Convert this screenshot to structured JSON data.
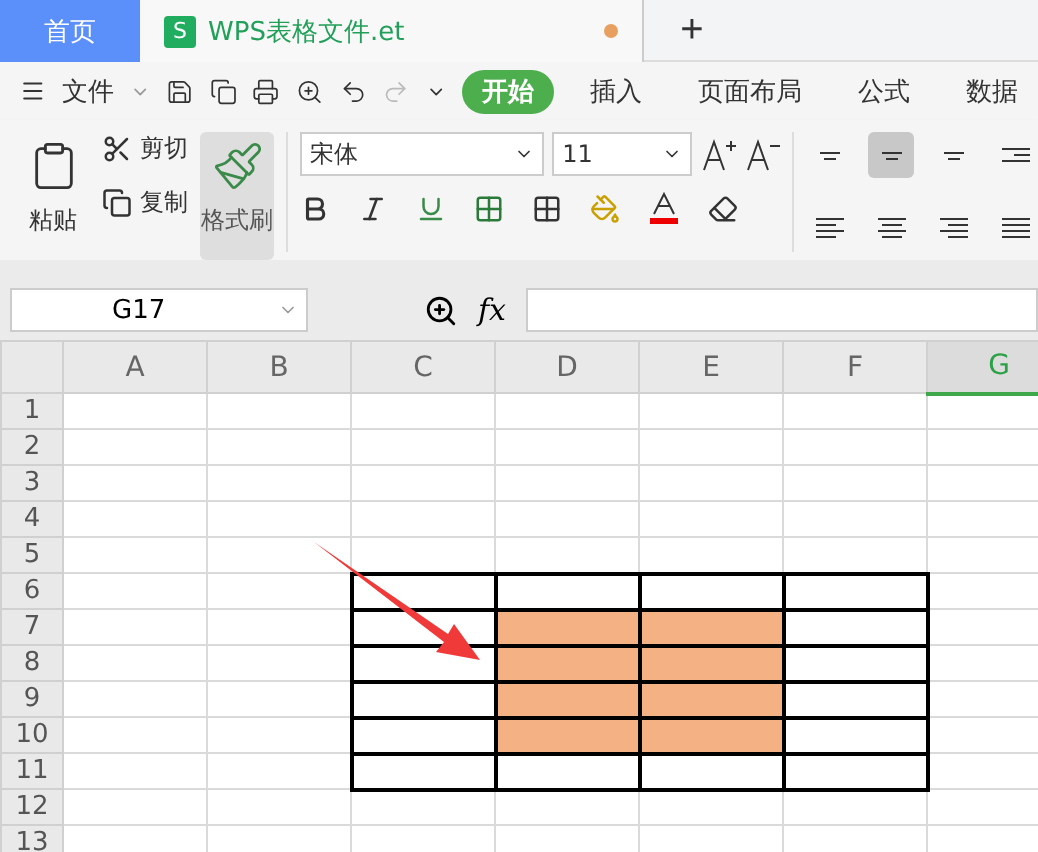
{
  "tabs": [
    {
      "label": "首页",
      "kind": "home",
      "selected": false
    },
    {
      "label": "WPS表格文件.et",
      "kind": "document",
      "selected": true,
      "modified": true,
      "logo": "S"
    }
  ],
  "new_tab": "+",
  "menu": {
    "file": "文件",
    "items": [
      {
        "label": "开始",
        "selected": true
      },
      {
        "label": "插入",
        "selected": false
      },
      {
        "label": "页面布局",
        "selected": false
      },
      {
        "label": "公式",
        "selected": false
      },
      {
        "label": "数据",
        "selected": false
      }
    ]
  },
  "ribbon": {
    "paste": "粘贴",
    "cut": "剪切",
    "copy": "复制",
    "format_painter": {
      "label": "格式刷",
      "pressed": true
    },
    "font": "宋体",
    "size": "11",
    "align": [
      {
        "kind": "top",
        "selected": false
      },
      {
        "kind": "middle",
        "selected": true
      },
      {
        "kind": "bottom",
        "selected": false
      },
      {
        "kind": "indent",
        "selected": false
      },
      {
        "kind": "left",
        "selected": false
      },
      {
        "kind": "center",
        "selected": false
      },
      {
        "kind": "right",
        "selected": false
      },
      {
        "kind": "justify",
        "selected": false
      }
    ]
  },
  "name_box": "G17",
  "formula_label": "fx",
  "sheet": {
    "columns": [
      {
        "label": "A",
        "selected": false
      },
      {
        "label": "B",
        "selected": false
      },
      {
        "label": "C",
        "selected": false
      },
      {
        "label": "D",
        "selected": false
      },
      {
        "label": "E",
        "selected": false
      },
      {
        "label": "F",
        "selected": false
      },
      {
        "label": "G",
        "selected": true
      }
    ],
    "rows": [
      {
        "label": "1",
        "cells": [
          {
            "bordered": false,
            "filled": false
          },
          {
            "bordered": false,
            "filled": false
          },
          {
            "bordered": false,
            "filled": false
          },
          {
            "bordered": false,
            "filled": false
          },
          {
            "bordered": false,
            "filled": false
          },
          {
            "bordered": false,
            "filled": false
          },
          {
            "bordered": false,
            "filled": false
          }
        ]
      },
      {
        "label": "2",
        "cells": [
          {
            "bordered": false,
            "filled": false
          },
          {
            "bordered": false,
            "filled": false
          },
          {
            "bordered": false,
            "filled": false
          },
          {
            "bordered": false,
            "filled": false
          },
          {
            "bordered": false,
            "filled": false
          },
          {
            "bordered": false,
            "filled": false
          },
          {
            "bordered": false,
            "filled": false
          }
        ]
      },
      {
        "label": "3",
        "cells": [
          {
            "bordered": false,
            "filled": false
          },
          {
            "bordered": false,
            "filled": false
          },
          {
            "bordered": false,
            "filled": false
          },
          {
            "bordered": false,
            "filled": false
          },
          {
            "bordered": false,
            "filled": false
          },
          {
            "bordered": false,
            "filled": false
          },
          {
            "bordered": false,
            "filled": false
          }
        ]
      },
      {
        "label": "4",
        "cells": [
          {
            "bordered": false,
            "filled": false
          },
          {
            "bordered": false,
            "filled": false
          },
          {
            "bordered": false,
            "filled": false
          },
          {
            "bordered": false,
            "filled": false
          },
          {
            "bordered": false,
            "filled": false
          },
          {
            "bordered": false,
            "filled": false
          },
          {
            "bordered": false,
            "filled": false
          }
        ]
      },
      {
        "label": "5",
        "cells": [
          {
            "bordered": false,
            "filled": false
          },
          {
            "bordered": false,
            "filled": false
          },
          {
            "bordered": false,
            "filled": false
          },
          {
            "bordered": false,
            "filled": false
          },
          {
            "bordered": false,
            "filled": false
          },
          {
            "bordered": false,
            "filled": false
          },
          {
            "bordered": false,
            "filled": false
          }
        ]
      },
      {
        "label": "6",
        "cells": [
          {
            "bordered": false,
            "filled": false
          },
          {
            "bordered": false,
            "filled": false
          },
          {
            "bordered": true,
            "filled": false
          },
          {
            "bordered": true,
            "filled": false
          },
          {
            "bordered": true,
            "filled": false
          },
          {
            "bordered": true,
            "filled": false
          },
          {
            "bordered": false,
            "filled": false
          }
        ]
      },
      {
        "label": "7",
        "cells": [
          {
            "bordered": false,
            "filled": false
          },
          {
            "bordered": false,
            "filled": false
          },
          {
            "bordered": true,
            "filled": false
          },
          {
            "bordered": true,
            "filled": true
          },
          {
            "bordered": true,
            "filled": true
          },
          {
            "bordered": true,
            "filled": false
          },
          {
            "bordered": false,
            "filled": false
          }
        ]
      },
      {
        "label": "8",
        "cells": [
          {
            "bordered": false,
            "filled": false
          },
          {
            "bordered": false,
            "filled": false
          },
          {
            "bordered": true,
            "filled": false
          },
          {
            "bordered": true,
            "filled": true
          },
          {
            "bordered": true,
            "filled": true
          },
          {
            "bordered": true,
            "filled": false
          },
          {
            "bordered": false,
            "filled": false
          }
        ]
      },
      {
        "label": "9",
        "cells": [
          {
            "bordered": false,
            "filled": false
          },
          {
            "bordered": false,
            "filled": false
          },
          {
            "bordered": true,
            "filled": false
          },
          {
            "bordered": true,
            "filled": true
          },
          {
            "bordered": true,
            "filled": true
          },
          {
            "bordered": true,
            "filled": false
          },
          {
            "bordered": false,
            "filled": false
          }
        ]
      },
      {
        "label": "10",
        "cells": [
          {
            "bordered": false,
            "filled": false
          },
          {
            "bordered": false,
            "filled": false
          },
          {
            "bordered": true,
            "filled": false
          },
          {
            "bordered": true,
            "filled": true
          },
          {
            "bordered": true,
            "filled": true
          },
          {
            "bordered": true,
            "filled": false
          },
          {
            "bordered": false,
            "filled": false
          }
        ]
      },
      {
        "label": "11",
        "cells": [
          {
            "bordered": false,
            "filled": false
          },
          {
            "bordered": false,
            "filled": false
          },
          {
            "bordered": true,
            "filled": false
          },
          {
            "bordered": true,
            "filled": false
          },
          {
            "bordered": true,
            "filled": false
          },
          {
            "bordered": true,
            "filled": false
          },
          {
            "bordered": false,
            "filled": false
          }
        ]
      },
      {
        "label": "12",
        "cells": [
          {
            "bordered": false,
            "filled": false
          },
          {
            "bordered": false,
            "filled": false
          },
          {
            "bordered": false,
            "filled": false
          },
          {
            "bordered": false,
            "filled": false
          },
          {
            "bordered": false,
            "filled": false
          },
          {
            "bordered": false,
            "filled": false
          },
          {
            "bordered": false,
            "filled": false
          }
        ]
      },
      {
        "label": "13",
        "cells": [
          {
            "bordered": false,
            "filled": false
          },
          {
            "bordered": false,
            "filled": false
          },
          {
            "bordered": false,
            "filled": false
          },
          {
            "bordered": false,
            "filled": false
          },
          {
            "bordered": false,
            "filled": false
          },
          {
            "bordered": false,
            "filled": false
          },
          {
            "bordered": false,
            "filled": false
          }
        ]
      }
    ]
  }
}
